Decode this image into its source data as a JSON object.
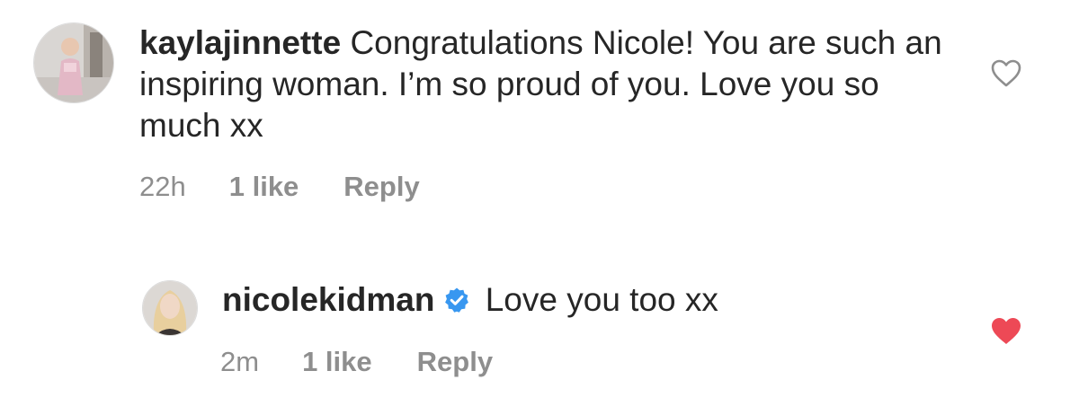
{
  "comments": [
    {
      "username": "kaylajinnette",
      "text": "Congratulations Nicole! You are such an inspiring woman. I’m so proud of you. Love you so much xx",
      "time": "22h",
      "likes": "1 like",
      "reply_label": "Reply",
      "avatar": "profile-photo",
      "liked": false
    },
    {
      "username": "nicolekidman",
      "verified": true,
      "text": "Love you too xx",
      "time": "2m",
      "likes": "1 like",
      "reply_label": "Reply",
      "avatar": "profile-photo",
      "liked": true
    }
  ],
  "colors": {
    "text": "#262626",
    "meta": "#8e8e8e",
    "verified_badge": "#3897f0",
    "heart_liked": "#ed4956",
    "heart_outline": "#8e8e8e"
  }
}
